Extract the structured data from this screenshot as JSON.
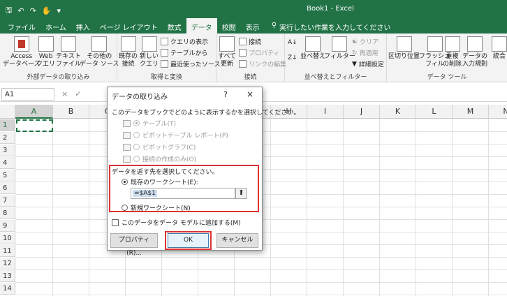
{
  "title_bar": {
    "qat_icons": [
      "save-icon",
      "undo-icon",
      "redo-icon",
      "touch-mode-icon",
      "customize-icon"
    ],
    "title": "Book1 - Excel"
  },
  "tabs": [
    {
      "label": "ファイル",
      "active": false
    },
    {
      "label": "ホーム",
      "active": false
    },
    {
      "label": "挿入",
      "active": false
    },
    {
      "label": "ページ レイアウト",
      "active": false
    },
    {
      "label": "数式",
      "active": false
    },
    {
      "label": "データ",
      "active": true
    },
    {
      "label": "校閲",
      "active": false
    },
    {
      "label": "表示",
      "active": false
    }
  ],
  "tell_me": "実行したい作業を入力してください",
  "ribbon": {
    "groups": {
      "external": "外部データの取り込み",
      "transform": "取得と変換",
      "connections": "接続",
      "sort_filter": "並べ替えとフィルター",
      "tools": "データ ツール"
    },
    "access": [
      "Access",
      "データベース"
    ],
    "web": [
      "Web",
      "クエリ"
    ],
    "text": [
      "テキスト",
      "ファイル"
    ],
    "other": [
      "その他の",
      "データ ソース"
    ],
    "existing": [
      "既存の",
      "接続"
    ],
    "new_query": [
      "新しい",
      "クエリ"
    ],
    "show_query": "クエリの表示",
    "from_table": "テーブルから",
    "recent": "最近使ったソース",
    "refresh": [
      "すべて",
      "更新"
    ],
    "connections_btn": "接続",
    "properties_btn": "プロパティ",
    "edit_links": "リンクの編集",
    "sort_az": "A↓",
    "sort_za": "Z↓",
    "sort": "並べ替え",
    "filter": "フィルター",
    "clear": "クリア",
    "reapply": "再適用",
    "advanced": "詳細設定",
    "text_to_cols": "区切り位置",
    "flash_fill": [
      "フラッシュ",
      "フィル"
    ],
    "remove_dup": [
      "重複",
      "の削除"
    ],
    "validation": [
      "データの",
      "入力規則"
    ],
    "consolidate": "統合"
  },
  "formula_bar": {
    "name_box": "A1",
    "cancel": "×",
    "enter": "✓"
  },
  "columns": [
    "A",
    "B",
    "C",
    "D",
    "E",
    "F",
    "G",
    "H",
    "I",
    "J",
    "K",
    "L",
    "M",
    "N"
  ],
  "rows": [
    "1",
    "2",
    "3",
    "4",
    "5",
    "6",
    "7",
    "8",
    "9",
    "10",
    "11",
    "12",
    "13",
    "14"
  ],
  "dialog": {
    "title": "データの取り込み",
    "help": "?",
    "close": "×",
    "prompt1": "このデータをブックでどのように表示するかを選択してください。",
    "opt_table": "テーブル(T)",
    "opt_pivot_table": "ピボットテーブル レポート(P)",
    "opt_pivot_chart": "ピボットグラフ(C)",
    "opt_connection": "接続の作成のみ(O)",
    "prompt2": "データを返す先を選択してください。",
    "opt_existing": "既存のワークシート(E):",
    "ref_value": "=$A$1",
    "opt_new": "新規ワークシート(N)",
    "add_model": "このデータをデータ モデルに追加する(M)",
    "btn_props": "プロパティ(R)...",
    "btn_ok": "OK",
    "btn_cancel": "キャンセル"
  },
  "colors": {
    "accent": "#217346",
    "highlight": "#dd3333"
  }
}
